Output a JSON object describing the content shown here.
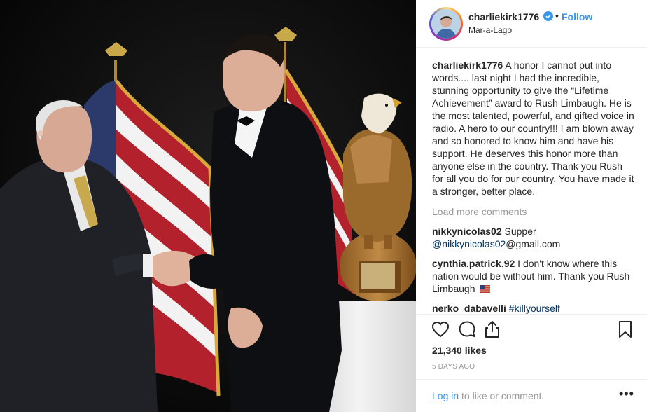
{
  "post": {
    "photo_alt": "Two men in tuxedos shaking hands on stage in front of American flags and a carved wooden eagle trophy"
  },
  "header": {
    "username": "charliekirk1776",
    "separator": "•",
    "follow_label": "Follow",
    "location": "Mar-a-Lago"
  },
  "caption": {
    "username": "charliekirk1776",
    "text": "A honor I cannot put into words.... last night I had the incredible, stunning opportunity to give the “Lifetime Achievement” award to Rush Limbaugh. He is the most talented, powerful, and gifted voice in radio. A hero to our country!!! I am blown away and so honored to know him and have his support. He deserves this honor more than anyone else in the country. Thank you Rush for all you do for our country. You have made it a stronger, better place."
  },
  "load_more_label": "Load more comments",
  "comments": [
    {
      "username": "nikkynicolas02",
      "text": "Supper",
      "mention": "@nikkynicolas02",
      "rest": "@gmail.com"
    },
    {
      "username": "cynthia.patrick.92",
      "text": "I don't know where this nation would be without him. Thank you Rush Limbaugh"
    },
    {
      "username": "nerko_dabavelli",
      "mention": "#killyourself"
    }
  ],
  "actions": {
    "like_icon": "heart-icon",
    "comment_icon": "comment-bubble-icon",
    "share_icon": "share-icon",
    "save_icon": "bookmark-icon"
  },
  "likes_label": "21,340 likes",
  "timestamp": "5 DAYS AGO",
  "login": {
    "link": "Log in",
    "rest": "to like or comment.",
    "more": "•••"
  },
  "colors": {
    "link_blue": "#3897f0",
    "mention_blue": "#003569",
    "muted_gray": "#999999",
    "text": "#262626"
  }
}
